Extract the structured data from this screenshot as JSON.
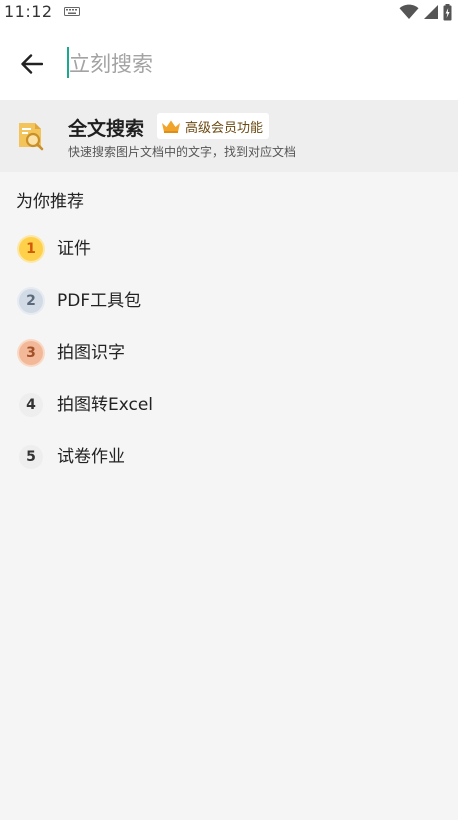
{
  "status_bar": {
    "time": "11:12",
    "icons": [
      "keyboard-icon",
      "wifi-icon",
      "signal-icon",
      "battery-icon"
    ]
  },
  "header": {
    "back_icon": "arrow-left-icon",
    "search_placeholder": "立刻搜索",
    "search_value": "",
    "accent_color": "#1aa88e"
  },
  "fulltext": {
    "title": "全文搜索",
    "badge": "高级会员功能",
    "description": "快速搜索图片文档中的文字，找到对应文档",
    "icon": "document-search-icon",
    "badge_icon": "crown-icon"
  },
  "recommendations": {
    "title": "为你推荐",
    "items": [
      {
        "rank": "1",
        "label": "证件"
      },
      {
        "rank": "2",
        "label": "PDF工具包"
      },
      {
        "rank": "3",
        "label": "拍图识字"
      },
      {
        "rank": "4",
        "label": "拍图转Excel"
      },
      {
        "rank": "5",
        "label": "试卷作业"
      }
    ]
  }
}
